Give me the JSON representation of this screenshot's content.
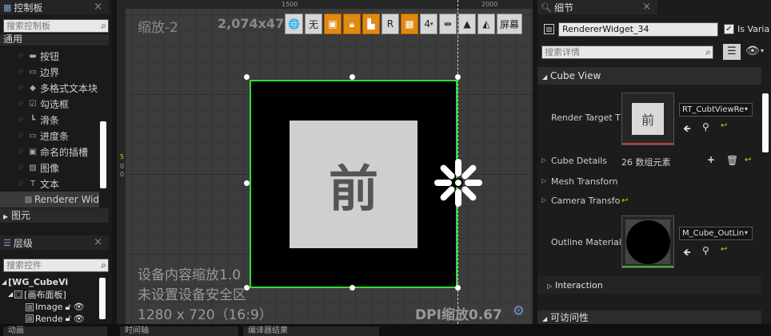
{
  "palette": {
    "tab_title": "控制板",
    "search_placeholder": "搜索控制板",
    "category_common": "通用",
    "items": [
      {
        "label": "按钮",
        "icon": "button-icon"
      },
      {
        "label": "边界",
        "icon": "border-icon"
      },
      {
        "label": "多格式文本块",
        "icon": "rich-text-icon"
      },
      {
        "label": "勾选框",
        "icon": "checkbox-icon"
      },
      {
        "label": "滑条",
        "icon": "slider-icon"
      },
      {
        "label": "进度条",
        "icon": "progress-bar-icon"
      },
      {
        "label": "命名的插槽",
        "icon": "named-slot-icon"
      },
      {
        "label": "图像",
        "icon": "image-icon"
      },
      {
        "label": "文本",
        "icon": "text-icon"
      },
      {
        "label": "Renderer Wid",
        "icon": "renderer-widget-icon"
      }
    ],
    "category_panel": "图元"
  },
  "hierarchy": {
    "tab_title": "层级",
    "search_placeholder": "搜索控件",
    "items": [
      {
        "label": "[WG_CubeVi"
      },
      {
        "label": "[画布面板]"
      },
      {
        "label": "Image"
      },
      {
        "label": "Rende"
      }
    ]
  },
  "viewport": {
    "zoom_label": "缩放-2",
    "resolution": "2,074x479",
    "ruler_1500": "1500",
    "ruler_2000": "2000",
    "ruler_side_5": "5",
    "ruler_side_0a": "0",
    "ruler_side_0b": "0",
    "device_scale": "设备内容缩放1.0",
    "safe_zone": "未设置设备安全区",
    "screen_size": "1280 x 720（16:9）",
    "dpi_scale": "DPI缩放0.67",
    "widget_char": "前",
    "toolbar": {
      "globe": "🌐",
      "none": "无",
      "r_label": "R",
      "grid_num": "4",
      "screen_label": "屏幕"
    }
  },
  "details": {
    "tab_title": "细节",
    "widget_name": "RendererWidget_34",
    "is_variable_label": "Is Varia",
    "search_placeholder": "搜索详情",
    "section_cube_view": "Cube View",
    "render_target_label": "Render Target T",
    "render_target_value": "RT_CubtViewRe",
    "thumb_char": "前",
    "cube_details_label": "Cube Details",
    "cube_details_value": "26 数组元素",
    "mesh_transform_label": "Mesh Transforn",
    "camera_transform_label": "Camera Transfo",
    "outline_material_label": "Outline Material",
    "outline_material_value": "M_Cube_OutLin",
    "interaction_label": "Interaction",
    "accessibility_label": "可访问性"
  },
  "bottom": {
    "tab1": "动画",
    "tab2": "时间轴",
    "tab3": "编译器结果"
  },
  "colors": {
    "selection_outline": "#2de02d",
    "toolbar_orange": "#e08a10",
    "reset_arrow_yellow": "#e8d000"
  }
}
